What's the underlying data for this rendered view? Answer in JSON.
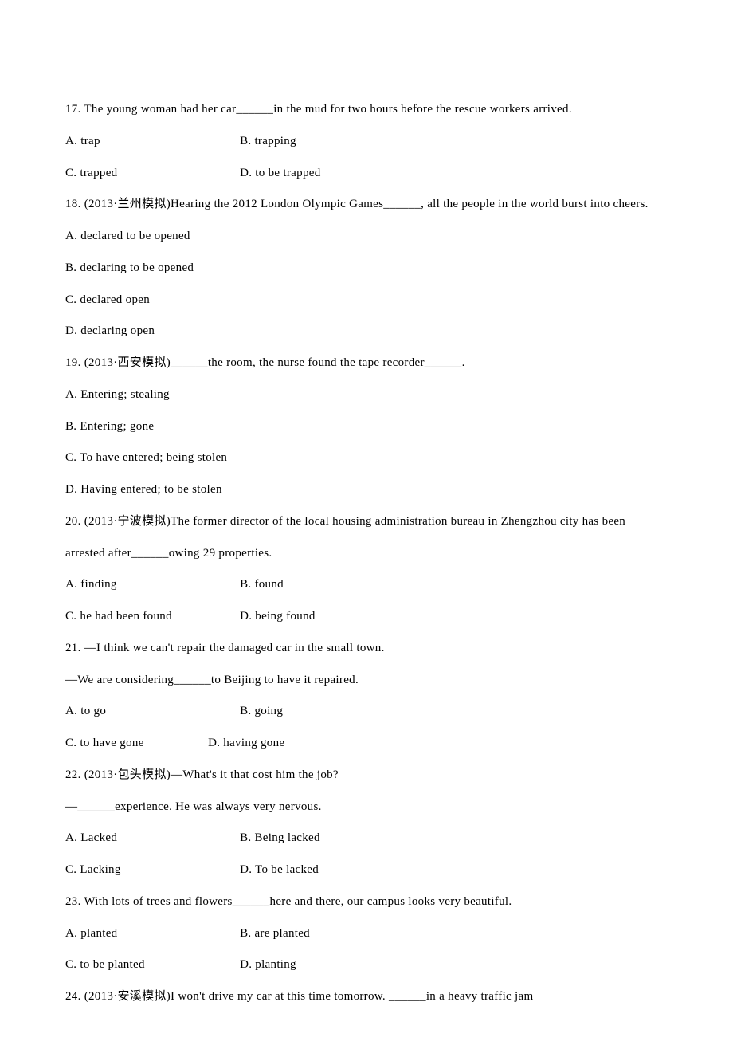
{
  "q17": {
    "text_pre": "17. The young woman had her car",
    "blank": "______",
    "text_post": "in the mud for two hours before the rescue workers arrived.",
    "a": "A. trap",
    "b": "B. trapping",
    "c": "C. trapped",
    "d": "D. to be trapped"
  },
  "q18": {
    "text_pre": "18. (2013·兰州模拟)Hearing the 2012 London Olympic Games",
    "blank": "______",
    "text_post": ", all the people in the world burst into cheers.",
    "a": "A. declared to be opened",
    "b": "B. declaring to be opened",
    "c": "C. declared open",
    "d": "D. declaring open"
  },
  "q19": {
    "text_pre": "19. (2013·西安模拟)",
    "blank1": "______",
    "text_mid": "the room, the nurse found the tape recorder",
    "blank2": "______",
    "text_post": ".",
    "a": "A. Entering; stealing",
    "b": "B. Entering; gone",
    "c": "C. To have entered; being stolen",
    "d": "D. Having entered; to be stolen"
  },
  "q20": {
    "text_pre": "20. (2013·宁波模拟)The former director of the local housing administration bureau in Zhengzhou city has been arrested after",
    "blank": "______",
    "text_post": "owing 29 properties.",
    "a": "A. finding",
    "b": "B. found",
    "c": "C. he had been found",
    "d": "D. being found"
  },
  "q21": {
    "line1": "21. —I think we can't repair the damaged car in the small town.",
    "line2_pre": "—We are considering",
    "blank": "______",
    "line2_post": "to Beijing to have it repaired.",
    "a": "A. to go",
    "b": "B. going",
    "c": "C. to have gone",
    "d": "D. having gone"
  },
  "q22": {
    "line1": "22. (2013·包头模拟)—What's it that cost him the job?",
    "line2_pre": "—",
    "blank": "______",
    "line2_post": "experience. He was always very nervous.",
    "a": "A. Lacked",
    "b": "B. Being lacked",
    "c": "C. Lacking",
    "d": "D. To be lacked"
  },
  "q23": {
    "text_pre": "23. With lots of trees and flowers",
    "blank": "______",
    "text_post": "here and there, our campus looks very beautiful.",
    "a": "A. planted",
    "b": "B. are planted",
    "c": "C. to be planted",
    "d": "D. planting"
  },
  "q24": {
    "text_pre": "24. (2013·安溪模拟)I won't drive my car at this time tomorrow. ",
    "blank": "______",
    "text_post": "in a heavy traffic jam"
  }
}
